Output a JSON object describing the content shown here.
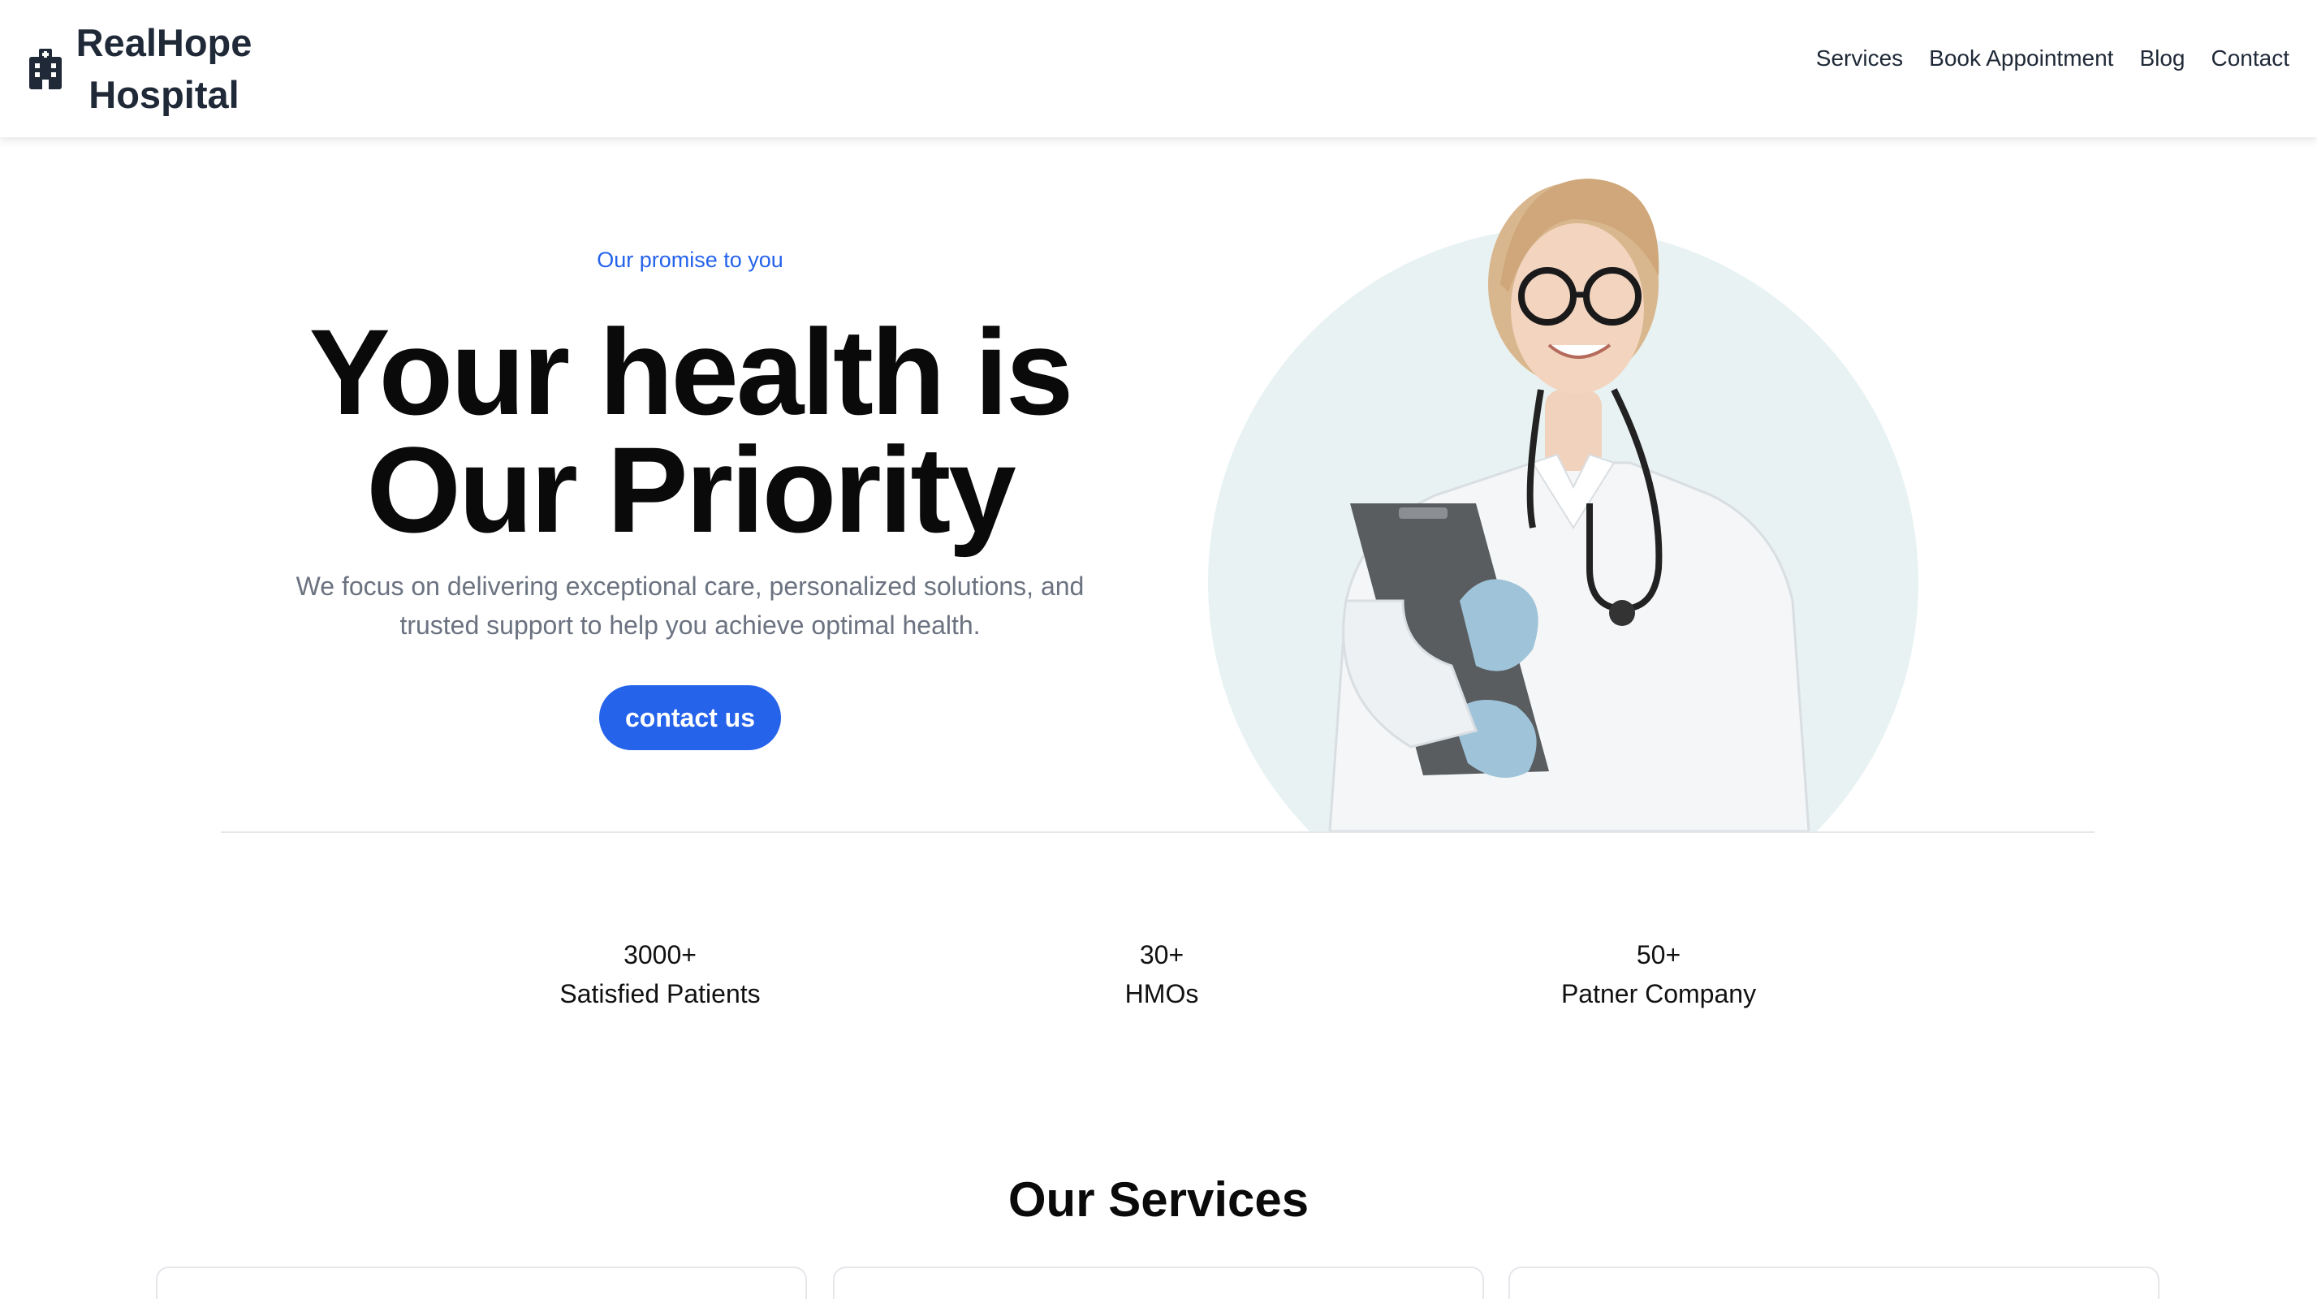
{
  "brand": {
    "name": "RealHope Hospital",
    "icon": "hospital-building-icon"
  },
  "nav": {
    "items": [
      {
        "label": "Services"
      },
      {
        "label": "Book Appointment"
      },
      {
        "label": "Blog"
      },
      {
        "label": "Contact"
      }
    ]
  },
  "hero": {
    "eyebrow": "Our promise to you",
    "headline_line1": "Your health is",
    "headline_line2": "Our Priority",
    "lead": "We focus on delivering exceptional care, personalized solutions, and trusted support to help you achieve optimal health.",
    "cta_label": "contact us"
  },
  "stats": [
    {
      "value": "3000+",
      "label": "Satisfied Patients"
    },
    {
      "value": "30+",
      "label": "HMOs"
    },
    {
      "value": "50+",
      "label": "Patner Company"
    }
  ],
  "services": {
    "title": "Our Services"
  },
  "colors": {
    "accent": "#2563eb",
    "text": "#111827",
    "muted": "#6b7280",
    "hero_circle": "#e8f2f2"
  }
}
